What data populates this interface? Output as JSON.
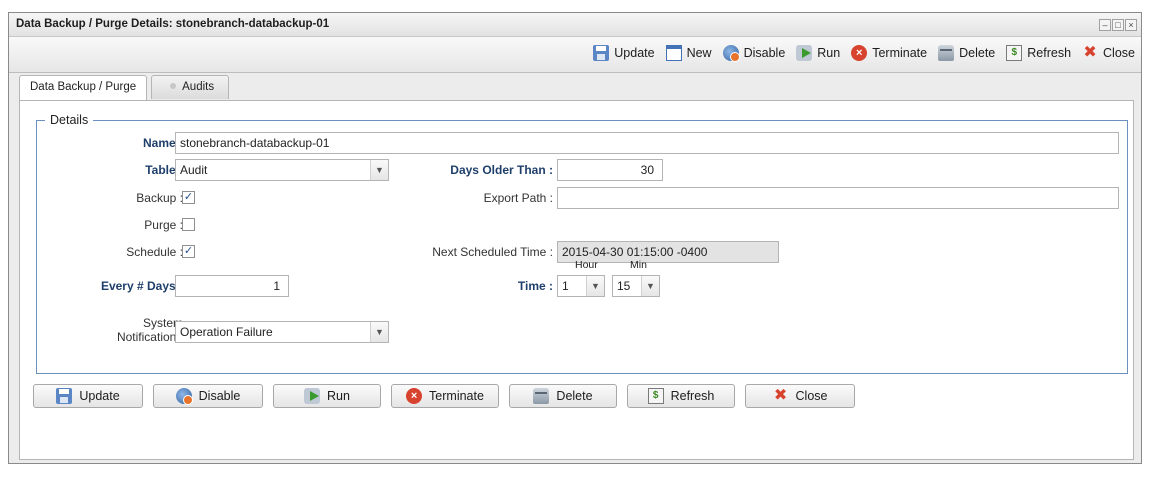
{
  "window": {
    "title": "Data Backup / Purge Details: stonebranch-databackup-01",
    "controls": [
      "minimize",
      "maximize",
      "close"
    ]
  },
  "toolbar": {
    "items": [
      {
        "label": "Update",
        "icon": "save-icon"
      },
      {
        "label": "New",
        "icon": "new-window-icon"
      },
      {
        "label": "Disable",
        "icon": "disable-icon"
      },
      {
        "label": "Run",
        "icon": "run-icon"
      },
      {
        "label": "Terminate",
        "icon": "terminate-icon"
      },
      {
        "label": "Delete",
        "icon": "delete-icon"
      },
      {
        "label": "Refresh",
        "icon": "refresh-icon"
      },
      {
        "label": "Close",
        "icon": "close-icon"
      }
    ]
  },
  "tabs": [
    {
      "label": "Data Backup / Purge",
      "active": true
    },
    {
      "label": "Audits",
      "active": false
    }
  ],
  "details": {
    "legend": "Details",
    "name_label": "Name :",
    "name_value": "stonebranch-databackup-01",
    "table_label": "Table :",
    "table_value": "Audit",
    "days_older_label": "Days Older Than :",
    "days_older_value": "30",
    "backup_label": "Backup :",
    "backup_checked": true,
    "export_path_label": "Export Path :",
    "export_path_value": "",
    "purge_label": "Purge :",
    "purge_checked": false,
    "schedule_label": "Schedule :",
    "schedule_checked": true,
    "next_time_label": "Next Scheduled Time :",
    "next_time_value": "2015-04-30 01:15:00 -0400",
    "every_days_label": "Every # Days :",
    "every_days_value": "1",
    "time_label": "Time :",
    "hour_label": "Hour",
    "hour_value": "1",
    "min_label": "Min",
    "min_value": "15",
    "notification_label_1": "System",
    "notification_label_2": "Notification :",
    "notification_value": "Operation Failure"
  },
  "bottom_buttons": [
    {
      "label": "Update",
      "icon": "save-icon"
    },
    {
      "label": "Disable",
      "icon": "disable-icon"
    },
    {
      "label": "Run",
      "icon": "run-icon"
    },
    {
      "label": "Terminate",
      "icon": "terminate-icon"
    },
    {
      "label": "Delete",
      "icon": "delete-icon"
    },
    {
      "label": "Refresh",
      "icon": "refresh-icon"
    },
    {
      "label": "Close",
      "icon": "close-icon"
    }
  ],
  "colors": {
    "label_bold": "#1f3f6b",
    "fieldset_border": "#6d8fbd",
    "terminate": "#d8432f"
  }
}
